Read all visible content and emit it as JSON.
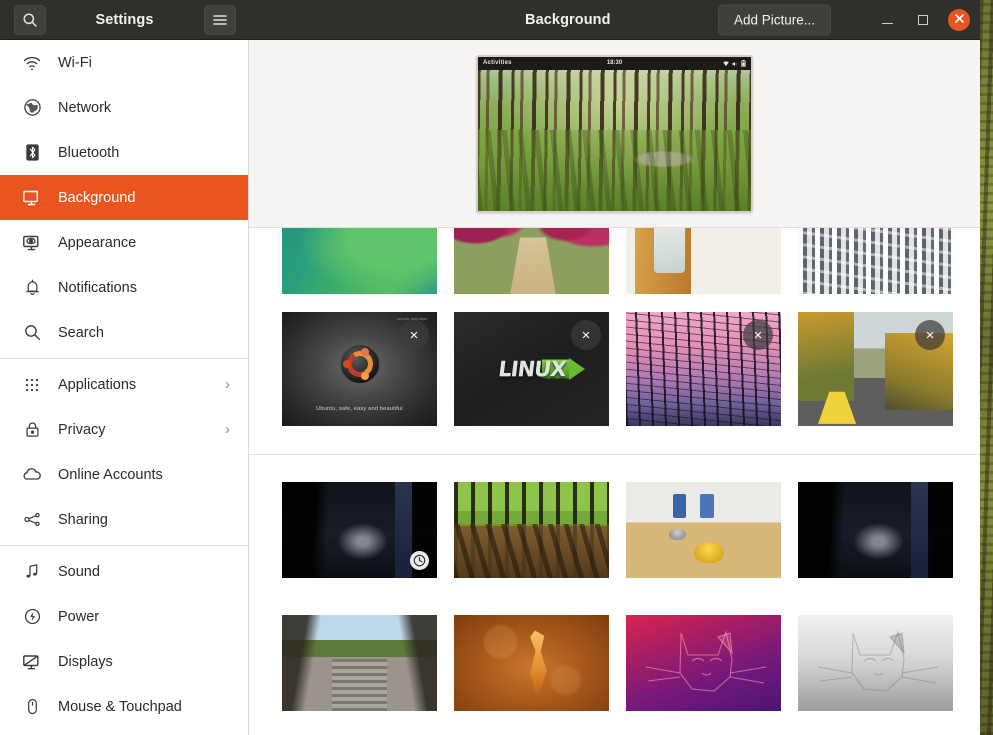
{
  "window": {
    "app_title": "Settings",
    "panel_title": "Background",
    "add_picture_label": "Add Picture...",
    "accent_color": "#e95420",
    "headerbar_color": "#302f2c"
  },
  "header_controls": {
    "search_icon": "search-icon",
    "menu_icon": "hamburger-menu-icon",
    "minimize_icon": "minimize-icon",
    "maximize_icon": "maximize-icon",
    "close_icon": "close-icon"
  },
  "sidebar": {
    "items": [
      {
        "label": "Wi-Fi",
        "icon": "wifi-icon",
        "active": false,
        "chevron": ""
      },
      {
        "label": "Network",
        "icon": "network-globe-icon",
        "active": false,
        "chevron": ""
      },
      {
        "label": "Bluetooth",
        "icon": "bluetooth-icon",
        "active": false,
        "chevron": ""
      },
      {
        "label": "Background",
        "icon": "background-icon",
        "active": true,
        "chevron": ""
      },
      {
        "label": "Appearance",
        "icon": "appearance-icon",
        "active": false,
        "chevron": ""
      },
      {
        "label": "Notifications",
        "icon": "bell-icon",
        "active": false,
        "chevron": ""
      },
      {
        "label": "Search",
        "icon": "search-icon",
        "active": false,
        "chevron": ""
      },
      {
        "label": "Applications",
        "icon": "grid-dots-icon",
        "active": false,
        "chevron": "›"
      },
      {
        "label": "Privacy",
        "icon": "lock-icon",
        "active": false,
        "chevron": "›"
      },
      {
        "label": "Online Accounts",
        "icon": "cloud-icon",
        "active": false,
        "chevron": ""
      },
      {
        "label": "Sharing",
        "icon": "share-nodes-icon",
        "active": false,
        "chevron": ""
      },
      {
        "label": "Sound",
        "icon": "music-note-icon",
        "active": false,
        "chevron": ""
      },
      {
        "label": "Power",
        "icon": "power-icon",
        "active": false,
        "chevron": ""
      },
      {
        "label": "Displays",
        "icon": "displays-icon",
        "active": false,
        "chevron": ""
      },
      {
        "label": "Mouse & Touchpad",
        "icon": "mouse-icon",
        "active": false,
        "chevron": ""
      }
    ],
    "separator_after_indexes": [
      6,
      10
    ]
  },
  "preview": {
    "topbar": {
      "activities_label": "Activities",
      "clock": "18:30",
      "status_icons": [
        "wifi-icon",
        "volume-icon",
        "battery-icon"
      ]
    },
    "wallpaper_name": "forest-sunlight"
  },
  "wallpaper_grid": {
    "rows": [
      {
        "section": "custom-pictures-top",
        "cropped_top": true,
        "items": [
          {
            "name": "green-abstract-wave",
            "art": "w-green",
            "remove_button": false,
            "clock_badge": false
          },
          {
            "name": "blossom-orchard-path",
            "art": "w-blossom",
            "remove_button": false,
            "clock_badge": false
          },
          {
            "name": "beach-drink-table",
            "art": "w-beach",
            "remove_button": false,
            "clock_badge": false
          },
          {
            "name": "snowy-forest",
            "art": "w-snow",
            "remove_button": false,
            "clock_badge": false
          }
        ]
      },
      {
        "section": "custom-pictures",
        "cropped_top": false,
        "items": [
          {
            "name": "ubuntu-logo-wallpaper",
            "art": "w-ubuntu",
            "remove_button": true,
            "clock_badge": false,
            "caption": "Ubuntu, safe, easy and beautiful",
            "corner_text": "ubuntu wallpaper"
          },
          {
            "name": "linux-logo-wallpaper",
            "art": "w-linux",
            "remove_button": true,
            "clock_badge": false,
            "logo_text": "LINUX"
          },
          {
            "name": "pink-sunset-branches",
            "art": "w-pinktree",
            "remove_button": true,
            "clock_badge": false
          },
          {
            "name": "autumn-mountain-road",
            "art": "w-road",
            "remove_button": true,
            "clock_badge": false
          }
        ]
      },
      {
        "section": "system-wallpapers-row-1",
        "cropped_top": false,
        "items": [
          {
            "name": "blue-tunnel-corridor",
            "art": "w-tunnel",
            "remove_button": false,
            "clock_badge": true
          },
          {
            "name": "sunlit-forest-floor",
            "art": "w-sunforest",
            "remove_button": false,
            "clock_badge": false
          },
          {
            "name": "curling-stones-rink",
            "art": "w-curling",
            "remove_button": false,
            "clock_badge": false
          },
          {
            "name": "blue-tunnel-corridor-2",
            "art": "w-tunnel",
            "remove_button": false,
            "clock_badge": false
          }
        ]
      },
      {
        "section": "system-wallpapers-row-2",
        "cropped_top": false,
        "items": [
          {
            "name": "suspension-bridge",
            "art": "w-bridge",
            "remove_button": false,
            "clock_badge": false
          },
          {
            "name": "orange-heron-artwork",
            "art": "w-heron",
            "remove_button": false,
            "clock_badge": false
          },
          {
            "name": "ubuntu-cat-dark",
            "art": "w-catpurple",
            "remove_button": false,
            "clock_badge": false
          },
          {
            "name": "ubuntu-cat-light",
            "art": "w-catgray",
            "remove_button": false,
            "clock_badge": false
          }
        ]
      }
    ],
    "remove_glyph": "×"
  }
}
